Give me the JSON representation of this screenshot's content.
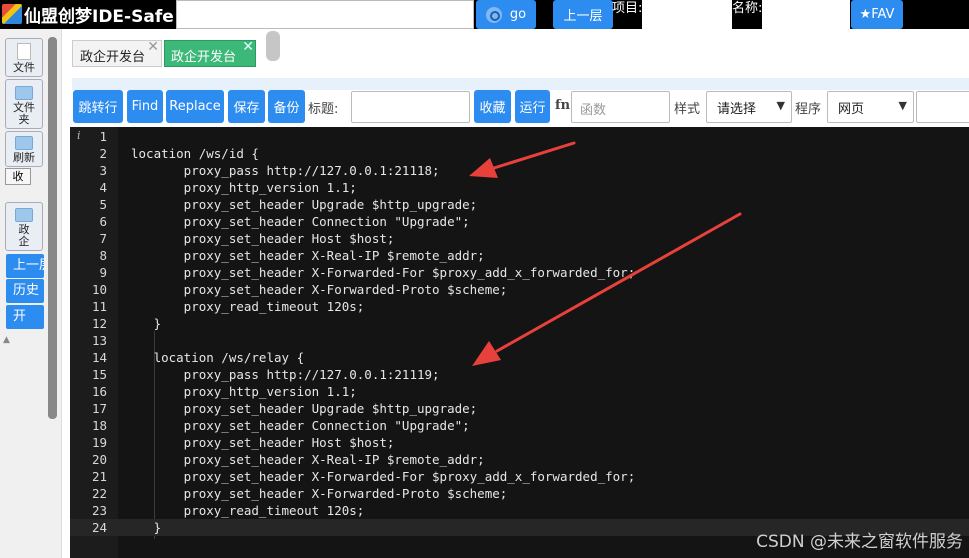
{
  "header": {
    "title": "仙盟创梦IDE-Safe",
    "go_label": "go",
    "up_label": "上一层",
    "project_label": "项目:",
    "name_label": "名称:",
    "fav_label": "★FAV"
  },
  "sidebar": {
    "file_label": "文件",
    "folder_label_1": "文件",
    "folder_label_2": "夹",
    "refresh_label": "刷新",
    "collapse_label": "收",
    "gov_label_1": "政",
    "gov_label_2": "企",
    "up_label": "上一层",
    "history_label": "历史",
    "open_label": "开"
  },
  "tabs": [
    {
      "label": "政企开发台",
      "active": false
    },
    {
      "label": "政企开发台",
      "active": true
    }
  ],
  "toolbar": {
    "jump_label": "跳转行",
    "find_label": "Find",
    "replace_label": "Replace",
    "save_label": "保存",
    "backup_label": "备份",
    "title_label": "标题:",
    "favorite_label": "收藏",
    "run_label": "运行",
    "fn_label": "fn",
    "function_placeholder": "函数",
    "style_label": "样式",
    "style_value": "请选择",
    "program_label": "程序",
    "program_value": "网页"
  },
  "editor": {
    "info_icon": "i",
    "lines": [
      {
        "n": "1",
        "text": ""
      },
      {
        "n": "2",
        "text": "location /ws/id {"
      },
      {
        "n": "3",
        "text": "       proxy_pass http://127.0.0.1:21118;"
      },
      {
        "n": "4",
        "text": "       proxy_http_version 1.1;"
      },
      {
        "n": "5",
        "text": "       proxy_set_header Upgrade $http_upgrade;"
      },
      {
        "n": "6",
        "text": "       proxy_set_header Connection \"Upgrade\";"
      },
      {
        "n": "7",
        "text": "       proxy_set_header Host $host;"
      },
      {
        "n": "8",
        "text": "       proxy_set_header X-Real-IP $remote_addr;"
      },
      {
        "n": "9",
        "text": "       proxy_set_header X-Forwarded-For $proxy_add_x_forwarded_for;"
      },
      {
        "n": "10",
        "text": "       proxy_set_header X-Forwarded-Proto $scheme;"
      },
      {
        "n": "11",
        "text": "       proxy_read_timeout 120s;"
      },
      {
        "n": "12",
        "text": "   }"
      },
      {
        "n": "13",
        "text": ""
      },
      {
        "n": "14",
        "text": "   location /ws/relay {"
      },
      {
        "n": "15",
        "text": "       proxy_pass http://127.0.0.1:21119;"
      },
      {
        "n": "16",
        "text": "       proxy_http_version 1.1;"
      },
      {
        "n": "17",
        "text": "       proxy_set_header Upgrade $http_upgrade;"
      },
      {
        "n": "18",
        "text": "       proxy_set_header Connection \"Upgrade\";"
      },
      {
        "n": "19",
        "text": "       proxy_set_header Host $host;"
      },
      {
        "n": "20",
        "text": "       proxy_set_header X-Real-IP $remote_addr;"
      },
      {
        "n": "21",
        "text": "       proxy_set_header X-Forwarded-For $proxy_add_x_forwarded_for;"
      },
      {
        "n": "22",
        "text": "       proxy_set_header X-Forwarded-Proto $scheme;"
      },
      {
        "n": "23",
        "text": "       proxy_read_timeout 120s;"
      },
      {
        "n": "24",
        "text": "   }"
      }
    ],
    "active_line": "24"
  },
  "watermark": "CSDN @未来之窗软件服务",
  "colors": {
    "accent": "#2d8cf0",
    "active_tab": "#3cb878",
    "editor_bg": "#141414",
    "annotation_arrow": "#e8413b"
  }
}
